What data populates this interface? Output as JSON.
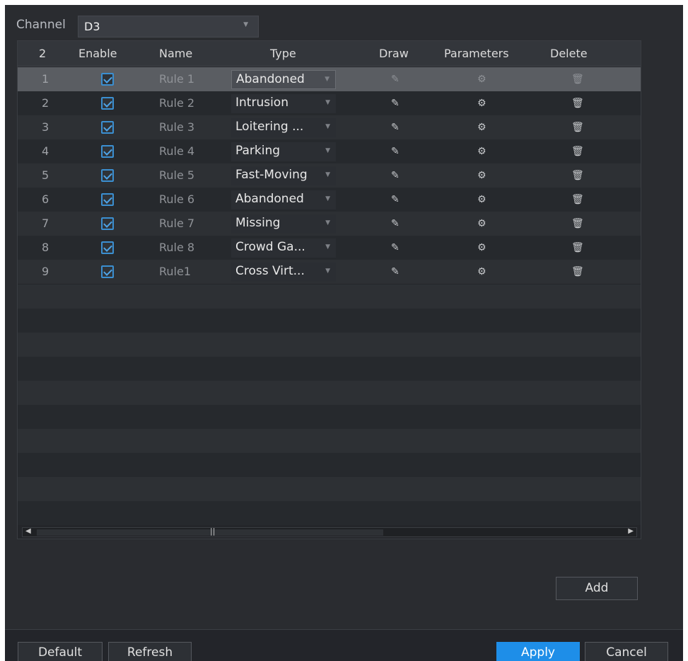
{
  "channel": {
    "label": "Channel",
    "value": "D3"
  },
  "table": {
    "headers": {
      "index": "2",
      "enable": "Enable",
      "name": "Name",
      "type": "Type",
      "draw": "Draw",
      "parameters": "Parameters",
      "delete": "Delete"
    },
    "rows": [
      {
        "index": "1",
        "enabled": true,
        "name": "Rule 1",
        "type": "Abandoned",
        "selected": true
      },
      {
        "index": "2",
        "enabled": true,
        "name": "Rule 2",
        "type": "Intrusion"
      },
      {
        "index": "3",
        "enabled": true,
        "name": "Rule 3",
        "type": "Loitering ..."
      },
      {
        "index": "4",
        "enabled": true,
        "name": "Rule 4",
        "type": "Parking"
      },
      {
        "index": "5",
        "enabled": true,
        "name": "Rule 5",
        "type": "Fast-Moving"
      },
      {
        "index": "6",
        "enabled": true,
        "name": "Rule 6",
        "type": "Abandoned"
      },
      {
        "index": "7",
        "enabled": true,
        "name": "Rule 7",
        "type": "Missing"
      },
      {
        "index": "8",
        "enabled": true,
        "name": "Rule 8",
        "type": "Crowd Ga..."
      },
      {
        "index": "9",
        "enabled": true,
        "name": "Rule1",
        "type": "Cross Virt..."
      }
    ]
  },
  "icons": {
    "draw": "pencil-icon",
    "parameters": "gear-icon",
    "delete": "trash-icon",
    "dropdown": "chevron-down-icon"
  },
  "buttons": {
    "add": "Add",
    "default": "Default",
    "refresh": "Refresh",
    "apply": "Apply",
    "cancel": "Cancel"
  },
  "colors": {
    "accent": "#1e8ee8",
    "panel_bg": "#2a2c30",
    "checkbox": "#3b8fd1"
  }
}
